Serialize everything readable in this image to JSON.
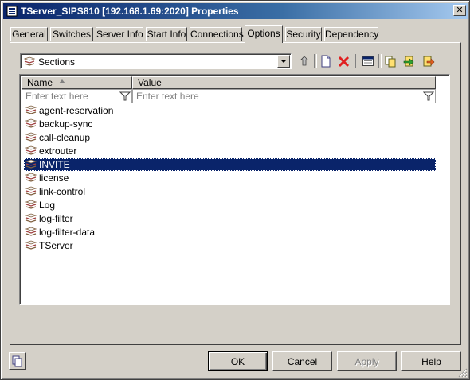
{
  "window": {
    "title": "TServer_SIPS810 [192.168.1.69:2020] Properties",
    "close_glyph": "✕"
  },
  "tabs": [
    {
      "label": "General"
    },
    {
      "label": "Switches"
    },
    {
      "label": "Server Info"
    },
    {
      "label": "Start Info"
    },
    {
      "label": "Connections"
    },
    {
      "label": "Options",
      "active": true
    },
    {
      "label": "Security"
    },
    {
      "label": "Dependency"
    }
  ],
  "toolbar": {
    "view_select": {
      "value": "Sections"
    }
  },
  "grid": {
    "columns": [
      {
        "label": "Name"
      },
      {
        "label": "Value"
      }
    ],
    "filter_placeholder": "Enter text here",
    "rows": [
      {
        "label": "agent-reservation"
      },
      {
        "label": "backup-sync"
      },
      {
        "label": "call-cleanup"
      },
      {
        "label": "extrouter"
      },
      {
        "label": "INVITE",
        "selected": true
      },
      {
        "label": "license"
      },
      {
        "label": "link-control"
      },
      {
        "label": "Log"
      },
      {
        "label": "log-filter"
      },
      {
        "label": "log-filter-data"
      },
      {
        "label": "TServer"
      }
    ]
  },
  "buttons": {
    "ok": "OK",
    "cancel": "Cancel",
    "apply": "Apply",
    "help": "Help"
  },
  "colors": {
    "selection": "#0a246a",
    "face": "#d4d0c8",
    "delete_red": "#e02020"
  }
}
